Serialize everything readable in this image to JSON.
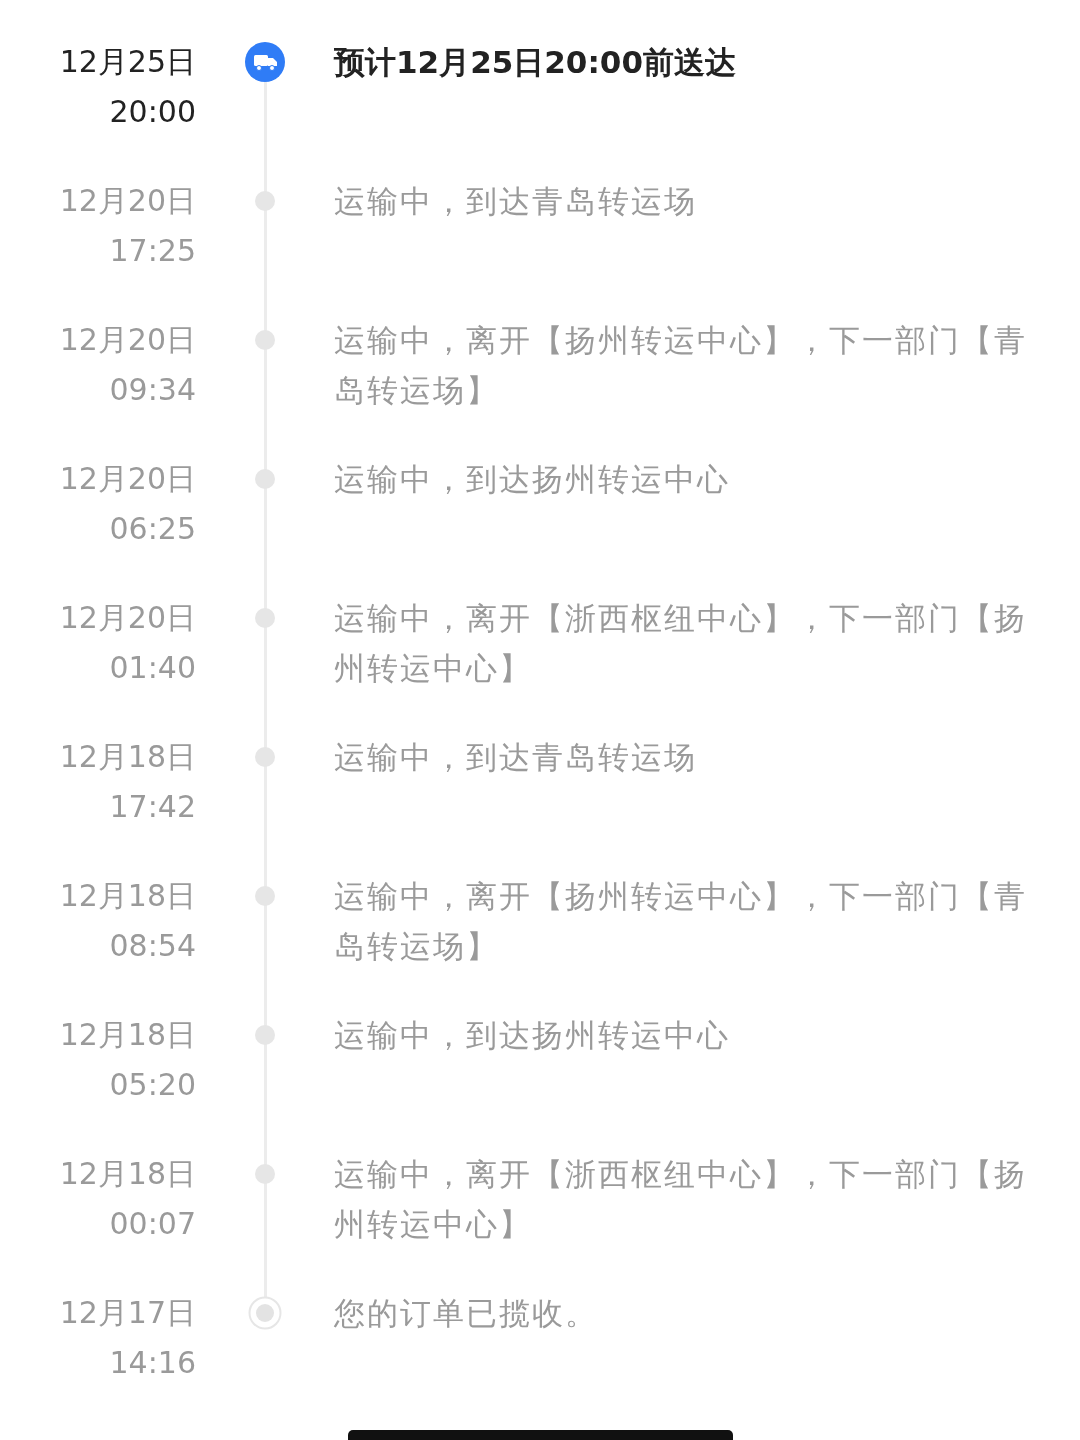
{
  "timeline": [
    {
      "kind": "current",
      "date": "12月25日",
      "time": "20:00",
      "text": "预计12月25日20:00前送达"
    },
    {
      "kind": "transit",
      "date": "12月20日",
      "time": "17:25",
      "text": "运输中，到达青岛转运场"
    },
    {
      "kind": "transit",
      "date": "12月20日",
      "time": "09:34",
      "text": "运输中，离开【扬州转运中心】，下一部门【青岛转运场】"
    },
    {
      "kind": "transit",
      "date": "12月20日",
      "time": "06:25",
      "text": "运输中，到达扬州转运中心"
    },
    {
      "kind": "transit",
      "date": "12月20日",
      "time": "01:40",
      "text": "运输中，离开【浙西枢纽中心】，下一部门【扬州转运中心】"
    },
    {
      "kind": "transit",
      "date": "12月18日",
      "time": "17:42",
      "text": "运输中，到达青岛转运场"
    },
    {
      "kind": "transit",
      "date": "12月18日",
      "time": "08:54",
      "text": "运输中，离开【扬州转运中心】，下一部门【青岛转运场】"
    },
    {
      "kind": "transit",
      "date": "12月18日",
      "time": "05:20",
      "text": "运输中，到达扬州转运中心"
    },
    {
      "kind": "transit",
      "date": "12月18日",
      "time": "00:07",
      "text": "运输中，离开【浙西枢纽中心】，下一部门【扬州转运中心】"
    },
    {
      "kind": "origin",
      "date": "12月17日",
      "time": "14:16",
      "text": "您的订单已揽收。"
    }
  ]
}
